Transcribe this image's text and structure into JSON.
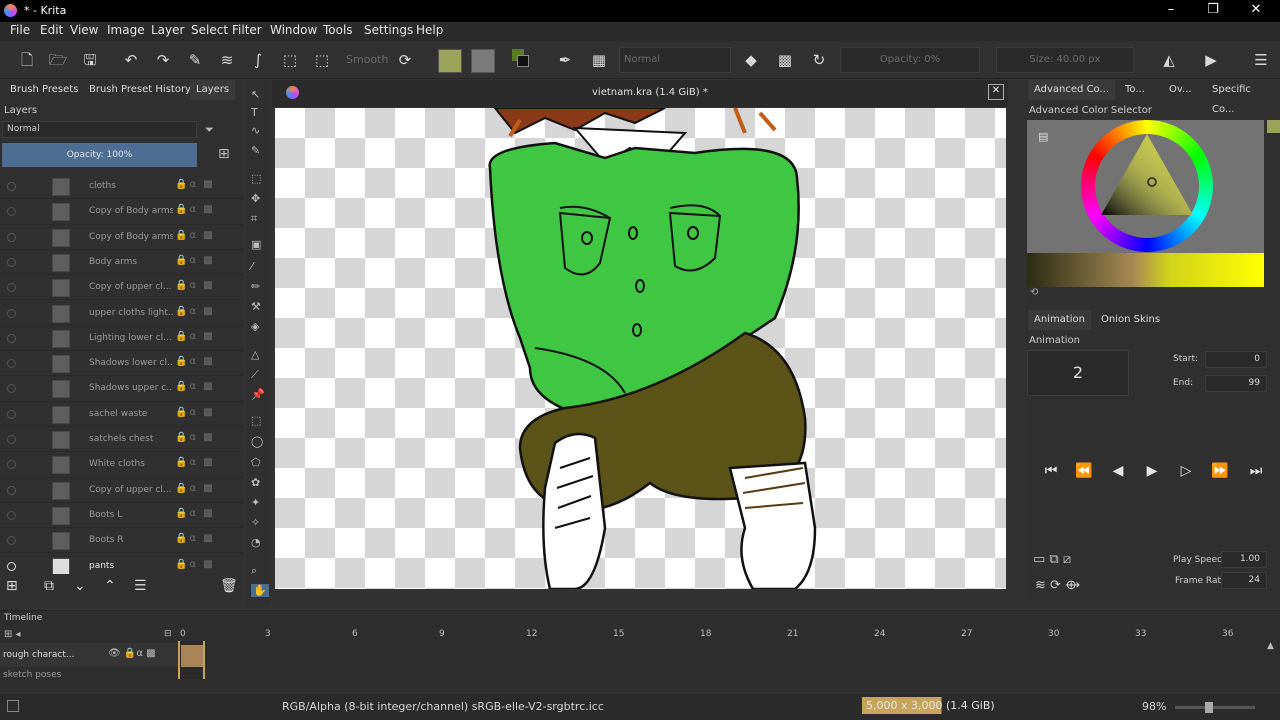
{
  "window": {
    "title": "* - Krita",
    "minimize": "–",
    "restore": "❐",
    "close": "✕"
  },
  "menu": [
    "File",
    "Edit",
    "View",
    "Image",
    "Layer",
    "Select",
    "Filter",
    "Window",
    "Tools",
    "Settings",
    "Help"
  ],
  "toolbar": {
    "smooth_label": "Smooth",
    "blend_mode": "Normal",
    "opacity": "Opacity: 0%",
    "size": "Size: 40.00 px"
  },
  "left_tabs": [
    "Brush Presets",
    "Brush Preset History",
    "Layers"
  ],
  "layers_panel": {
    "title": "Layers",
    "blend_mode": "Normal",
    "opacity": "Opacity:  100%"
  },
  "layers": [
    "cloths",
    "Copy of Body arms",
    "Copy of Body arms",
    "Body arms",
    "Copy of upper cl...",
    "upper cloths light...",
    "Lighting lower cl...",
    "Shadows lower cl...",
    "Shadows upper c...",
    "sachel waste",
    "satchels chest",
    "White cloths",
    "Copy of upper cl...",
    "Boots L",
    "Boots R",
    "pants"
  ],
  "document": {
    "title": "vietnam.kra (1.4 GiB) *"
  },
  "right_tabs": [
    "Advanced Co...",
    "To...",
    "Ov...",
    "Specific Co..."
  ],
  "color_selector": {
    "title": "Advanced Color Selector"
  },
  "animation": {
    "tabs": [
      "Animation",
      "Onion Skins"
    ],
    "title": "Animation",
    "current_frame": "2",
    "start_label": "Start:",
    "start_value": "0",
    "end_label": "End:",
    "end_value": "99",
    "play_speed_label": "Play Speed:",
    "play_speed_value": "1.00",
    "frame_rate_label": "Frame Rate:",
    "frame_rate_value": "24"
  },
  "timeline": {
    "title": "Timeline",
    "frame_numbers": [
      "0",
      "3",
      "6",
      "9",
      "12",
      "15",
      "18",
      "21",
      "24",
      "27",
      "30",
      "33",
      "36"
    ],
    "tracks": [
      "rough charact...",
      "sketch poses"
    ]
  },
  "status": {
    "color_profile": "RGB/Alpha (8-bit integer/channel)  sRGB-elle-V2-srgbtrc.icc",
    "image_size": "5,000 x 3,000 (1.4 GiB)",
    "zoom": "98%"
  },
  "colors": {
    "accent": "#4d6e92",
    "highlight": "#c7a45c",
    "fg_swatch": "#9aa35a",
    "shirt": "#3fc743",
    "pants": "#5b5318"
  }
}
